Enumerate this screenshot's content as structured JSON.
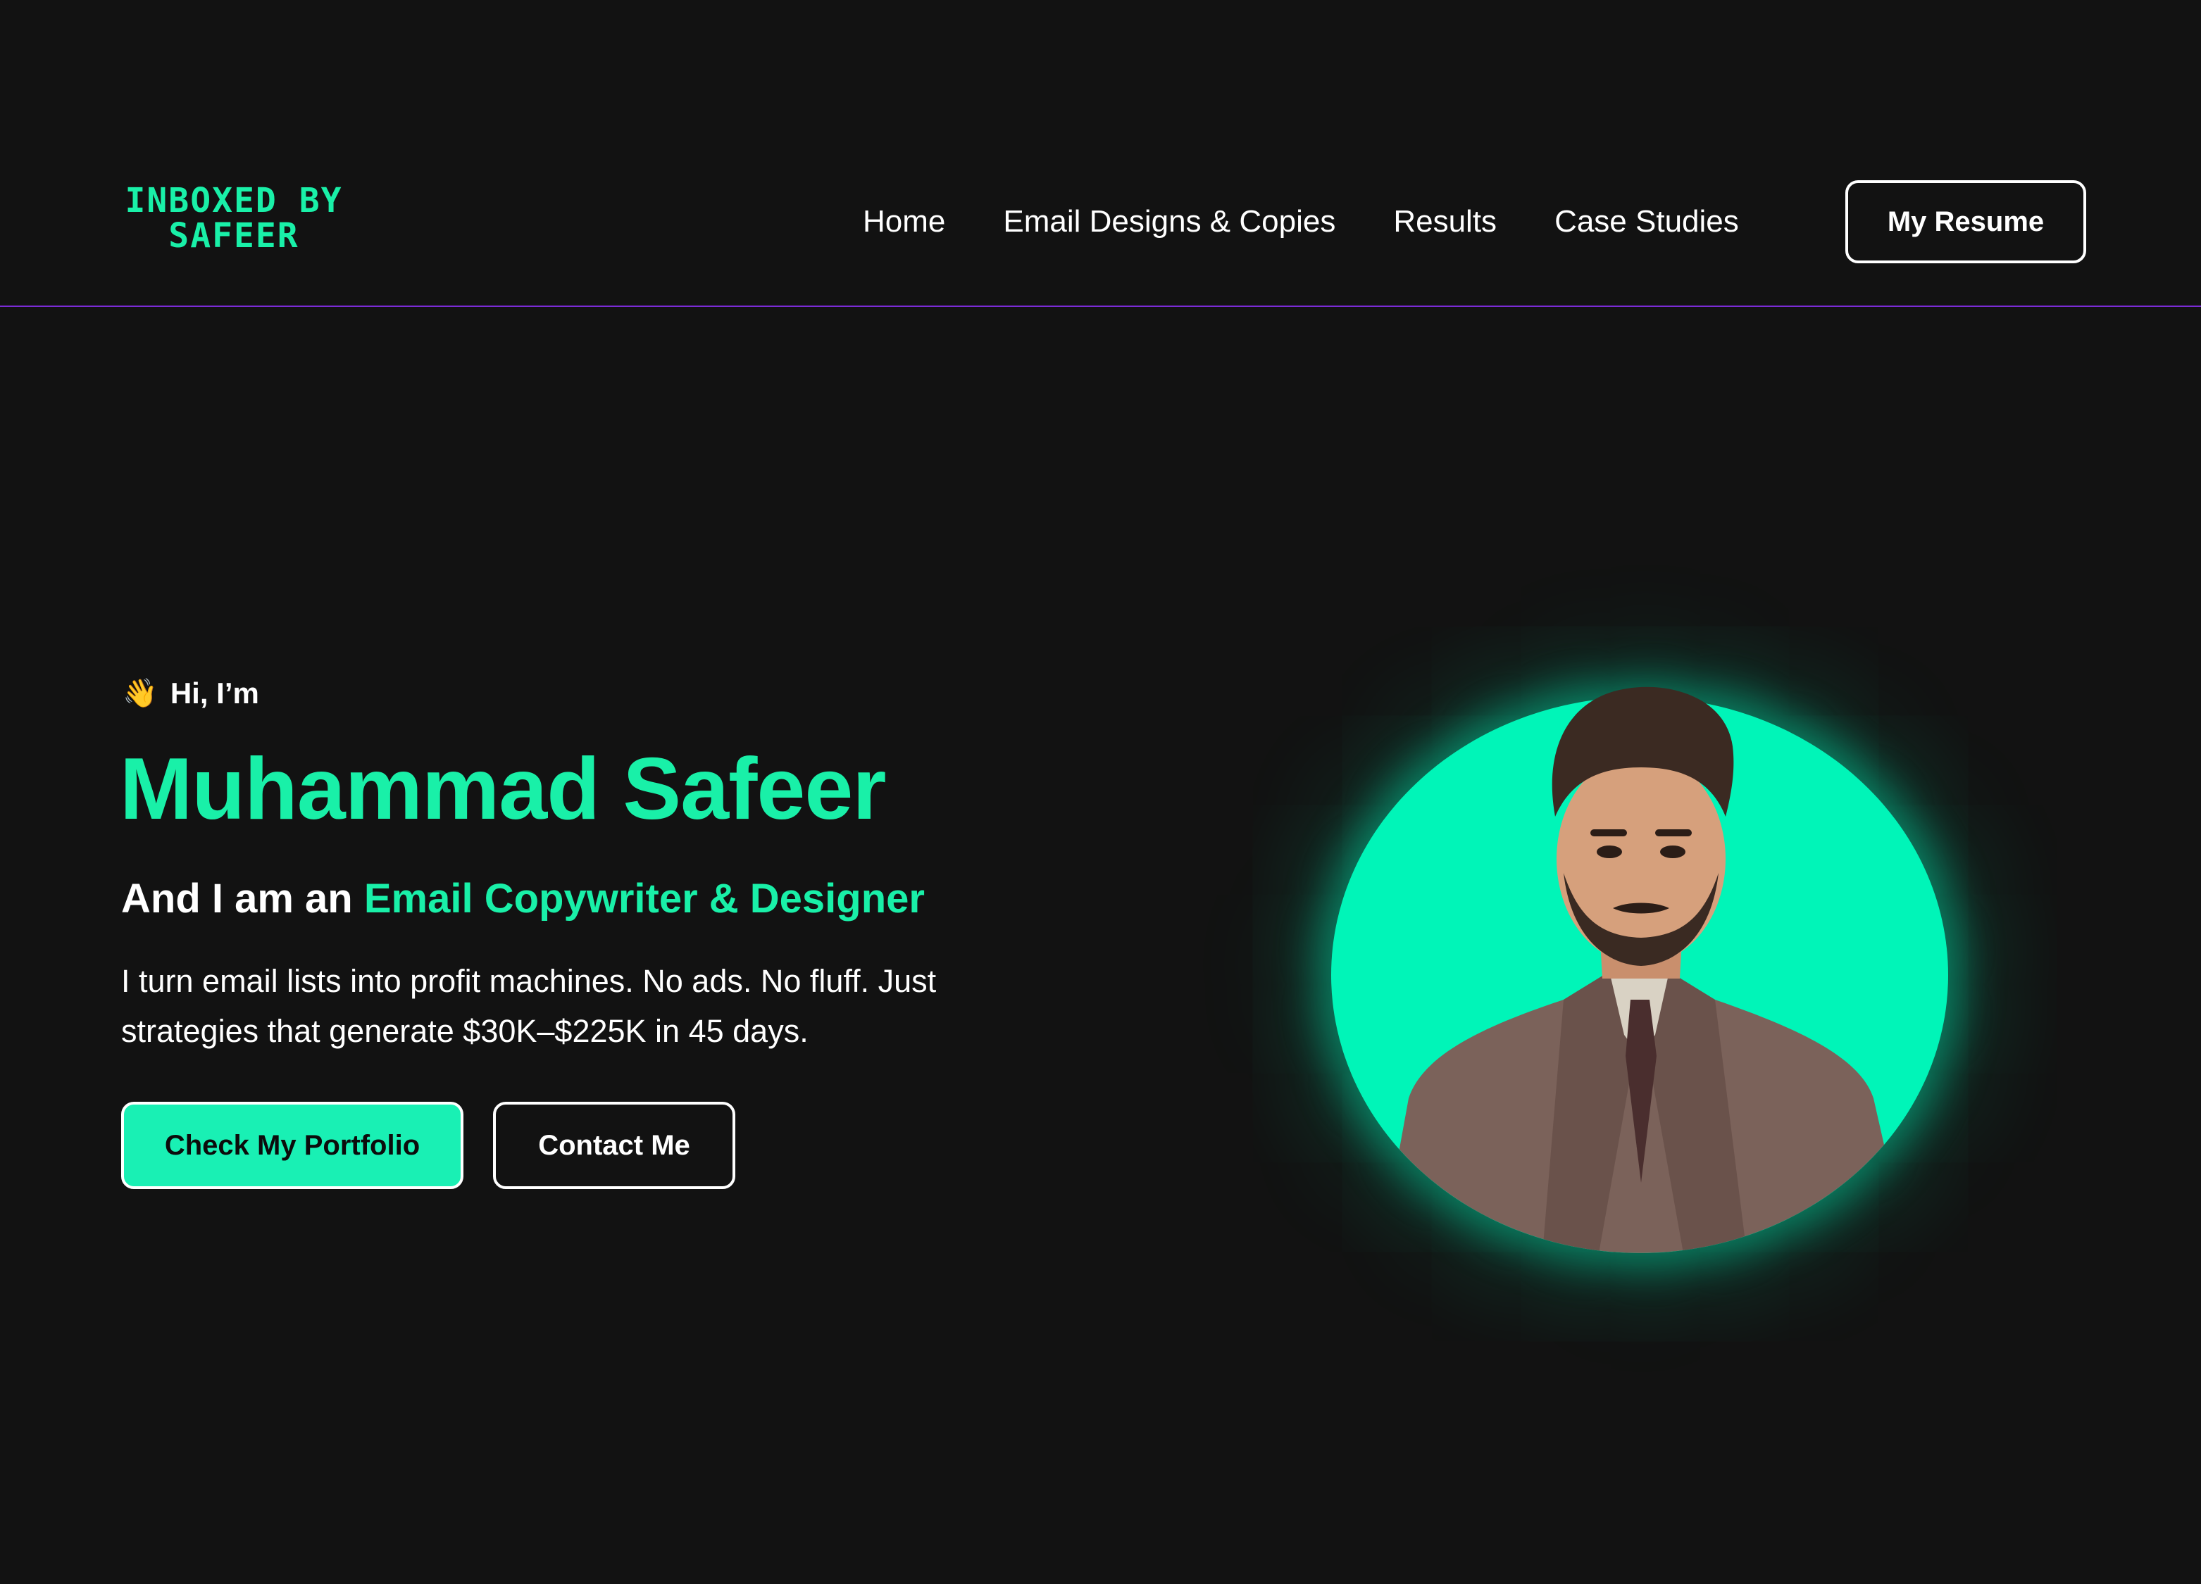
{
  "header": {
    "logo_line1": "INBOXED BY",
    "logo_line2": "SAFEER",
    "nav": [
      "Home",
      "Email Designs & Copies",
      "Results",
      "Case Studies"
    ],
    "resume_label": "My Resume"
  },
  "hero": {
    "greeting": "Hi, I’m",
    "greeting_icon": "waving-hand-icon",
    "name": "Muhammad Safeer",
    "role_prefix": "And I am an",
    "role_accent": "Email Copywriter & Designer",
    "description": "I turn email lists into profit machines. No ads. No fluff. Just strategies that generate $30K–$225K in 45 days.",
    "primary_button": "Check My Portfolio",
    "secondary_button": "Contact Me"
  },
  "colors": {
    "background": "#121212",
    "accent": "#19f0a8",
    "divider": "#7a2bd6",
    "text": "#ffffff"
  }
}
